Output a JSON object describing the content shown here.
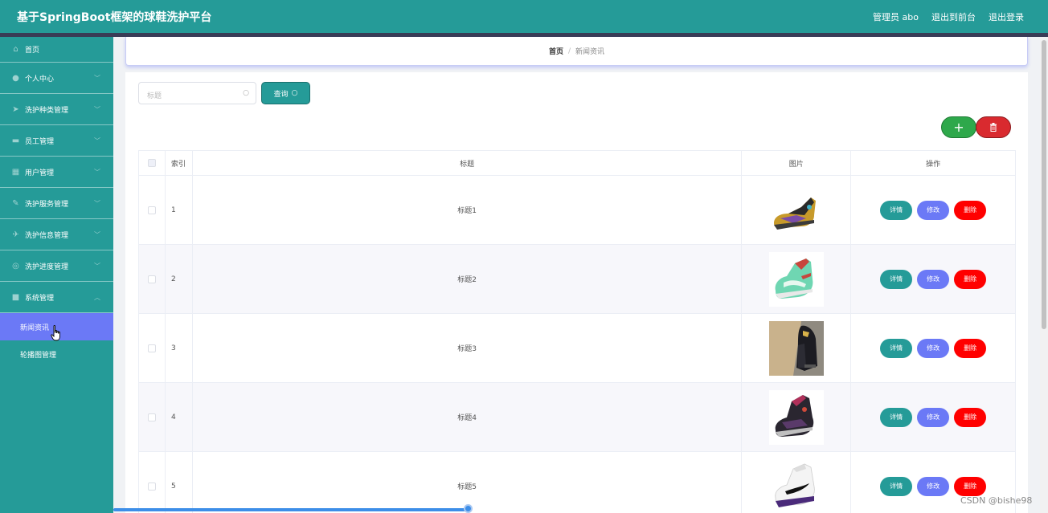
{
  "header": {
    "title": "基于SpringBoot框架的球鞋洗护平台",
    "user_label": "管理员 abo",
    "back_label": "退出到前台",
    "logout_label": "退出登录"
  },
  "sidebar": {
    "items": [
      {
        "label": "首页",
        "icon": "home-icon"
      },
      {
        "label": "个人中心",
        "icon": "user-icon"
      },
      {
        "label": "洗护种类管理",
        "icon": "send-icon"
      },
      {
        "label": "员工管理",
        "icon": "monitor-icon"
      },
      {
        "label": "用户管理",
        "icon": "chart-icon"
      },
      {
        "label": "洗护服务管理",
        "icon": "tool-icon"
      },
      {
        "label": "洗护信息管理",
        "icon": "plane-icon"
      },
      {
        "label": "洗护进度管理",
        "icon": "globe-icon"
      },
      {
        "label": "系统管理",
        "icon": "trash-icon"
      }
    ],
    "subitems": [
      {
        "label": "新闻资讯",
        "active": true
      },
      {
        "label": "轮播图管理",
        "active": false
      }
    ]
  },
  "breadcrumb": {
    "home": "首页",
    "separator": "/",
    "current": "新闻资讯"
  },
  "search": {
    "placeholder": "标题",
    "query_label": "查询"
  },
  "actions": {
    "add_symbol": "+",
    "delete_symbol": "🗑"
  },
  "table": {
    "headers": {
      "index": "索引",
      "title": "标题",
      "image": "图片",
      "action": "操作"
    },
    "buttons": {
      "detail": "详情",
      "edit": "修改",
      "delete": "删除"
    },
    "rows": [
      {
        "index": "1",
        "title": "标题1"
      },
      {
        "index": "2",
        "title": "标题2"
      },
      {
        "index": "3",
        "title": "标题3"
      },
      {
        "index": "4",
        "title": "标题4"
      },
      {
        "index": "5",
        "title": "标题5"
      }
    ]
  },
  "watermark": "CSDN @bishe98",
  "colors": {
    "primary": "#259b98",
    "accent": "#6b79f6",
    "danger": "#ff0000",
    "success": "#2ea84b"
  }
}
